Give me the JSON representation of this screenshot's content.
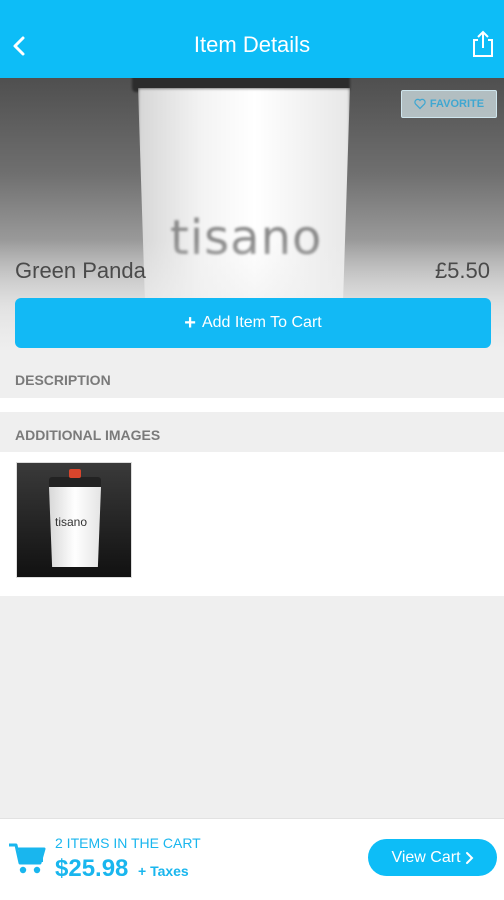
{
  "header": {
    "title": "Item Details",
    "back_icon": "chevron-left-icon",
    "share_icon": "share-icon"
  },
  "hero": {
    "favorite_label": "FAVORITE",
    "logo_text": "tisano"
  },
  "product": {
    "name": "Green Panda",
    "price": "£5.50"
  },
  "actions": {
    "add_to_cart_label": "Add Item To Cart"
  },
  "sections": {
    "description_title": "DESCRIPTION",
    "additional_images_title": "ADDITIONAL IMAGES"
  },
  "thumbnail": {
    "logo_text": "tisano"
  },
  "footer": {
    "cart_count": "2 ITEMS IN THE CART",
    "cart_total": "$25.98",
    "taxes": "+ Taxes",
    "view_cart_label": "View Cart"
  },
  "colors": {
    "accent": "#0dbdf7",
    "text": "#4a4a4a",
    "section_text": "#7a7a7a"
  }
}
